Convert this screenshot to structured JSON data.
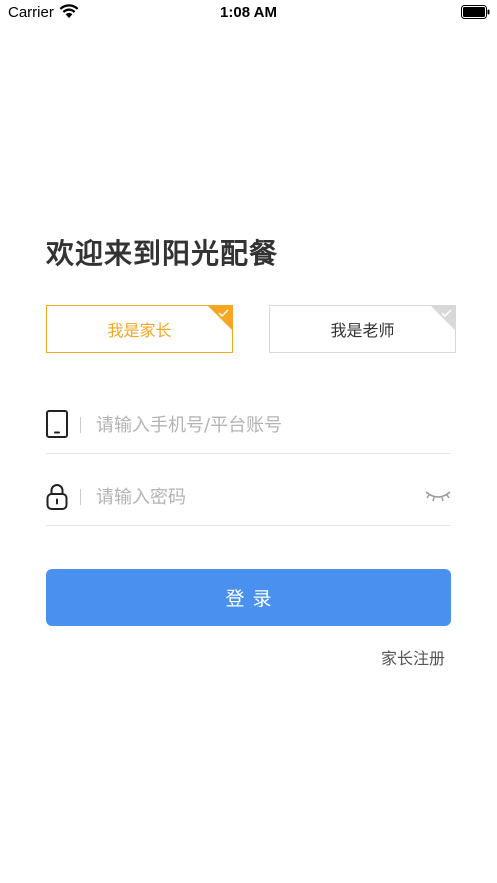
{
  "status_bar": {
    "carrier": "Carrier",
    "time": "1:08 AM"
  },
  "welcome_title": "欢迎来到阳光配餐",
  "roles": {
    "parent": {
      "label": "我是家长",
      "selected": true
    },
    "teacher": {
      "label": "我是老师",
      "selected": false
    }
  },
  "fields": {
    "account": {
      "value": "",
      "placeholder": "请输入手机号/平台账号",
      "icon": "phone-icon"
    },
    "password": {
      "value": "",
      "placeholder": "请输入密码",
      "icon": "lock-icon",
      "toggle_icon": "eye-closed-icon"
    }
  },
  "login_label": "登录",
  "register_label": "家长注册",
  "colors": {
    "accent_orange": "#f5a623",
    "primary_blue": "#4a90ee",
    "inactive_gray": "#d8d8d8"
  }
}
